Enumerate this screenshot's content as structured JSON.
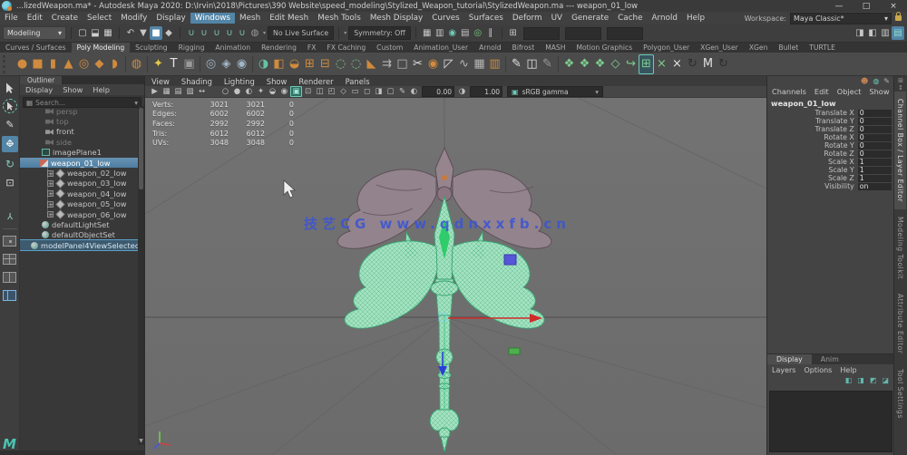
{
  "window": {
    "title": "...lizedWeapon.ma* - Autodesk Maya 2020: D:\\Irvin\\2018\\Pictures\\390 Website\\speed_modeling\\Stylized_Weapon_tutorial\\StylizedWeapon.ma  ---  weapon_01_low",
    "minimize": "—",
    "maximize": "□",
    "close": "×"
  },
  "branding": {
    "logo": "M"
  },
  "menubar": {
    "items": [
      {
        "t": "File"
      },
      {
        "t": "Edit"
      },
      {
        "t": "Create"
      },
      {
        "t": "Select"
      },
      {
        "t": "Modify"
      },
      {
        "t": "Display"
      },
      {
        "t": "Windows",
        "s": "active"
      },
      {
        "t": "Mesh"
      },
      {
        "t": "Edit Mesh"
      },
      {
        "t": "Mesh Tools"
      },
      {
        "t": "Mesh Display"
      },
      {
        "t": "Curves"
      },
      {
        "t": "Surfaces"
      },
      {
        "t": "Deform"
      },
      {
        "t": "UV"
      },
      {
        "t": "Generate"
      },
      {
        "t": "Cache"
      },
      {
        "t": "Arnold"
      },
      {
        "t": "Help"
      }
    ],
    "workspace_label": "Workspace:",
    "workspace_value": "Maya Classic*",
    "workspace_dd": "▾"
  },
  "statusline": {
    "mode": "Modeling",
    "mode_dd": "▾",
    "file_icons": [
      {
        "n": "new-scene-icon",
        "g": "▢",
        "c": "#cfcfcf"
      },
      {
        "n": "open-scene-icon",
        "g": "⬓",
        "c": "#cfcfcf"
      },
      {
        "n": "save-scene-icon",
        "g": "▦",
        "c": "#cfcfcf"
      }
    ],
    "edit_icons": [
      {
        "n": "undo-icon",
        "g": "↶",
        "c": "#c6c6c6"
      },
      {
        "n": "select-hierarchy-icon",
        "g": "▼",
        "c": "#c6c6c6"
      },
      {
        "n": "select-object-icon",
        "g": "■",
        "c": "#fff",
        "s": "active"
      },
      {
        "n": "select-component-icon",
        "g": "◆",
        "c": "#c6c6c6"
      }
    ],
    "snap_icons": [
      {
        "n": "snap-grid-icon",
        "g": "∪",
        "c": "#7ec8b8"
      },
      {
        "n": "snap-curve-icon",
        "g": "∪",
        "c": "#7ec8b8"
      },
      {
        "n": "snap-point-icon",
        "g": "∪",
        "c": "#7ec8b8"
      },
      {
        "n": "snap-projected-center-icon",
        "g": "∪",
        "c": "#7ec8b8"
      },
      {
        "n": "snap-view-plane-icon",
        "g": "∪",
        "c": "#7ec8b8"
      },
      {
        "n": "make-live-icon",
        "g": "◍",
        "c": "#9a9a9a"
      }
    ],
    "no_live_surface": "No Live Surface",
    "symmetry": "Symmetry: Off",
    "render_icons": [
      {
        "n": "render-icon",
        "g": "▦",
        "c": "#c6c6c6"
      },
      {
        "n": "ipr-render-icon",
        "g": "▥",
        "c": "#c6c6c6"
      },
      {
        "n": "render-settings-icon",
        "g": "◉",
        "c": "#6ec9b8"
      },
      {
        "n": "display-layers-icon",
        "g": "▤",
        "c": "#c6c6c6"
      },
      {
        "n": "launch-render-view-icon",
        "g": "◎",
        "c": "#7ec87e"
      },
      {
        "n": "pause-icon",
        "g": "∥",
        "c": "#c6c6c6"
      }
    ],
    "input_icon": {
      "n": "quick-input-icon",
      "g": "⊞",
      "c": "#c6c6c6"
    },
    "right_icons": [
      {
        "n": "sidebar-attribute-editor-icon",
        "g": "◨",
        "c": "#c6c6c6"
      },
      {
        "n": "sidebar-tool-settings-icon",
        "g": "◧",
        "c": "#c6c6c6"
      },
      {
        "n": "sidebar-channel-box-icon",
        "g": "▥",
        "c": "#c6c6c6"
      },
      {
        "n": "sidebar-modeling-toolkit-icon",
        "g": "▤",
        "c": "#8fe0d0",
        "s": "active"
      }
    ]
  },
  "shelf": {
    "tabs": [
      {
        "t": "Curves / Surfaces"
      },
      {
        "t": "Poly Modeling",
        "s": "active"
      },
      {
        "t": "Sculpting"
      },
      {
        "t": "Rigging"
      },
      {
        "t": "Animation"
      },
      {
        "t": "Rendering"
      },
      {
        "t": "FX"
      },
      {
        "t": "FX Caching"
      },
      {
        "t": "Custom"
      },
      {
        "t": "Animation_User"
      },
      {
        "t": "Arnold"
      },
      {
        "t": "Bifrost"
      },
      {
        "t": "MASH"
      },
      {
        "t": "Motion Graphics"
      },
      {
        "t": "Polygon_User"
      },
      {
        "t": "XGen_User"
      },
      {
        "t": "XGen"
      },
      {
        "t": "Bullet"
      },
      {
        "t": "TURTLE"
      }
    ],
    "icons": [
      {
        "n": "poly-sphere-icon",
        "g": "●",
        "c": "#d08b3e"
      },
      {
        "n": "poly-cube-icon",
        "g": "■",
        "c": "#d08b3e"
      },
      {
        "n": "poly-cylinder-icon",
        "g": "▮",
        "c": "#d08b3e"
      },
      {
        "n": "poly-cone-icon",
        "g": "▲",
        "c": "#d08b3e"
      },
      {
        "n": "poly-torus-icon",
        "g": "◎",
        "c": "#d08b3e"
      },
      {
        "n": "poly-plane-icon",
        "g": "◆",
        "c": "#d08b3e"
      },
      {
        "n": "poly-disc-icon",
        "g": "◗",
        "c": "#d08b3e"
      },
      {
        "s": "sep"
      },
      {
        "n": "platonic-solid-icon",
        "g": "◍",
        "c": "#d08b3e"
      },
      {
        "s": "sep"
      },
      {
        "n": "super-shape-icon",
        "g": "✦",
        "c": "#e6c84a"
      },
      {
        "n": "poly-type-icon",
        "g": "T",
        "c": "#e4e4e4"
      },
      {
        "n": "type-editor-icon",
        "g": "▣",
        "c": "#9a9a9a"
      },
      {
        "s": "sep"
      },
      {
        "n": "camera-aim-icon",
        "g": "◎",
        "c": "#9fb6c6"
      },
      {
        "n": "camera-key-icon",
        "g": "◈",
        "c": "#9fb6c6"
      },
      {
        "n": "motion-trail-icon",
        "g": "◉",
        "c": "#9fb6c6"
      },
      {
        "s": "sep"
      },
      {
        "n": "combine-icon",
        "g": "◑",
        "c": "#66c2a4"
      },
      {
        "n": "separate-icon",
        "g": "◧",
        "c": "#d08b3e"
      },
      {
        "n": "extract-icon",
        "g": "◒",
        "c": "#d08b3e"
      },
      {
        "n": "boolean-union-icon",
        "g": "⊞",
        "c": "#d08b3e"
      },
      {
        "n": "boolean-difference-icon",
        "g": "⊟",
        "c": "#d08b3e"
      },
      {
        "n": "bridge-icon",
        "g": "◌",
        "c": "#7ccc8e"
      },
      {
        "n": "append-polygon-icon",
        "g": "◌",
        "c": "#7ccc8e"
      },
      {
        "n": "bevel-icon",
        "g": "◣",
        "c": "#d08b3e"
      },
      {
        "n": "smooth-icon",
        "g": "⇉",
        "c": "#b5b5b5"
      },
      {
        "n": "cube-wire-icon",
        "g": "□",
        "c": "#b5b5b5"
      },
      {
        "n": "multi-cut-icon",
        "g": "✂",
        "c": "#e0e0e0"
      },
      {
        "n": "circularize-icon",
        "g": "◉",
        "c": "#d08b3e"
      },
      {
        "n": "fold-icon",
        "g": "◸",
        "c": "#e0e0e0"
      },
      {
        "n": "edge-flow-icon",
        "g": "∿",
        "c": "#b5b5b5"
      },
      {
        "n": "uv-snapshot-icon",
        "g": "▦",
        "c": "#b5b5b5"
      },
      {
        "n": "poly-count-icon",
        "g": "▥",
        "c": "#d08b3e"
      },
      {
        "s": "sep"
      },
      {
        "n": "create-curve-icon",
        "g": "✎",
        "c": "#e0e0e0"
      },
      {
        "n": "edit-curve-icon",
        "g": "◫",
        "c": "#e0e0e0"
      },
      {
        "n": "pencil-curve-icon",
        "g": "✎",
        "c": "#9a9a9a"
      },
      {
        "s": "sep"
      },
      {
        "n": "quad-draw-icon",
        "g": "❖",
        "c": "#7ccc8e"
      },
      {
        "n": "quad-relax-icon",
        "g": "❖",
        "c": "#7ccc8e"
      },
      {
        "n": "quad-tweak-icon",
        "g": "❖",
        "c": "#7ccc8e"
      },
      {
        "n": "green-cube-icon",
        "g": "◇",
        "c": "#7ccc8e"
      },
      {
        "n": "edge-loop-icon",
        "g": "↪",
        "c": "#7ccc8e"
      },
      {
        "n": "grid-fill-icon",
        "g": "⊞",
        "c": "#7ccc8e",
        "s": "active"
      },
      {
        "n": "cut-green-icon",
        "g": "×",
        "c": "#7ccc8e"
      },
      {
        "n": "delete-edge-icon",
        "g": "×",
        "c": "#e0e0e0"
      },
      {
        "n": "target-weld-icon",
        "g": "↻",
        "c": "#2e2e2e"
      },
      {
        "n": "mirror-icon",
        "g": "M",
        "c": "#e0e0e0"
      },
      {
        "n": "symmetrize-icon",
        "g": "↻",
        "c": "#2e2e2e"
      }
    ]
  },
  "toolbox": {
    "tools": [
      "select-tool",
      "lasso-tool",
      "paint-select-tool",
      "move-tool",
      "rotate-tool",
      "scale-tool",
      "ik-handle-tool",
      "layout-single-pane",
      "layout-four-pane",
      "layout-two-pane",
      "layout-outliner-persp"
    ]
  },
  "outliner": {
    "tab": "Outliner",
    "menus": [
      {
        "t": "Display"
      },
      {
        "t": "Show"
      },
      {
        "t": "Help"
      }
    ],
    "search": "Search...",
    "items": [
      {
        "t": "persp",
        "i": "camera",
        "s": "dim",
        "ind": 28
      },
      {
        "t": "top",
        "i": "camera",
        "s": "dim",
        "ind": 28
      },
      {
        "t": "front",
        "i": "camera",
        "ind": 28
      },
      {
        "t": "side",
        "i": "camera",
        "s": "dim",
        "ind": 28
      },
      {
        "t": "imagePlane1",
        "i": "imageplane",
        "ind": 24
      },
      {
        "t": "weapon_01_low",
        "i": "mesh-main",
        "s": "selected",
        "ind": 22
      },
      {
        "t": "weapon_02_low",
        "i": "mesh",
        "x": "+",
        "ind": 30
      },
      {
        "t": "weapon_03_low",
        "i": "mesh",
        "x": "+",
        "ind": 30
      },
      {
        "t": "weapon_04_low",
        "i": "mesh",
        "x": "+",
        "ind": 30
      },
      {
        "t": "weapon_05_low",
        "i": "mesh",
        "x": "+",
        "ind": 30
      },
      {
        "t": "weapon_06_low",
        "i": "mesh",
        "x": "+",
        "ind": 30
      },
      {
        "t": "defaultLightSet",
        "i": "set",
        "ind": 24
      },
      {
        "t": "defaultObjectSet",
        "i": "set",
        "ind": 24
      },
      {
        "t": "modelPanel4ViewSelectedSet",
        "i": "panelset",
        "s": "hl",
        "ind": 12
      }
    ]
  },
  "viewport": {
    "menus": [
      {
        "t": "View"
      },
      {
        "t": "Shading"
      },
      {
        "t": "Lighting"
      },
      {
        "t": "Show"
      },
      {
        "t": "Renderer"
      },
      {
        "t": "Panels"
      }
    ],
    "toolbar": {
      "icons": [
        {
          "n": "select-camera-icon",
          "g": "▶"
        },
        {
          "n": "camera-attributes-icon",
          "g": "▦"
        },
        {
          "n": "bookmarks-icon",
          "g": "▤"
        },
        {
          "n": "image-plane-icon",
          "g": "▧"
        },
        {
          "n": "pan-zoom-icon",
          "g": "↔"
        },
        {
          "s": "sep",
          "g": ""
        },
        {
          "n": "wireframe-icon",
          "g": "○"
        },
        {
          "n": "shaded-icon",
          "g": "●"
        },
        {
          "n": "textured-icon",
          "g": "◐"
        },
        {
          "n": "lights-icon",
          "g": "✦"
        },
        {
          "n": "shadows-icon",
          "g": "◒"
        },
        {
          "n": "screen-ao-icon",
          "g": "◉"
        },
        {
          "n": "textured-mode-icon",
          "g": "▣",
          "s": "active"
        },
        {
          "n": "isolate-select-icon",
          "g": "⊡"
        },
        {
          "n": "xray-icon",
          "g": "◫"
        },
        {
          "n": "wireframe-on-shaded-icon",
          "g": "◰"
        },
        {
          "n": "default-material-icon",
          "g": "◇"
        },
        {
          "n": "field-chart-icon",
          "g": "▭"
        },
        {
          "n": "resolution-gate-icon",
          "g": "◻"
        },
        {
          "n": "gate-mask-icon",
          "g": "◨"
        },
        {
          "n": "safe-action-icon",
          "g": "▢"
        },
        {
          "n": "grease-pencil-icon",
          "g": "✎"
        }
      ],
      "exposure_icon": "◐",
      "exposure": "0.00",
      "gamma_icon": "◑",
      "gamma": "1.00",
      "view_transform_label": "sRGB gamma",
      "dd": "▾"
    },
    "hud": {
      "rows": [
        {
          "t": "Verts:",
          "a": "3021",
          "b": "3021",
          "c": "0"
        },
        {
          "t": "Edges:",
          "a": "6002",
          "b": "6002",
          "c": "0"
        },
        {
          "t": "Faces:",
          "a": "2992",
          "b": "2992",
          "c": "0"
        },
        {
          "t": "Tris:",
          "a": "6012",
          "b": "6012",
          "c": "0"
        },
        {
          "t": "UVs:",
          "a": "3048",
          "b": "3048",
          "c": "0"
        }
      ]
    },
    "watermark": "技艺CG www.qdnxxfb.cn"
  },
  "channel_box": {
    "icons": [
      {
        "n": "character-set-icon",
        "g": "☻",
        "c": "#cc8855"
      },
      {
        "n": "world-space-icon",
        "g": "◍",
        "c": "#6ec9b8"
      },
      {
        "n": "edit-channels-icon",
        "g": "✎",
        "c": "#b5b5b5"
      }
    ],
    "menus": [
      {
        "t": "Channels"
      },
      {
        "t": "Edit"
      },
      {
        "t": "Object"
      },
      {
        "t": "Show"
      }
    ],
    "object": "weapon_01_low",
    "rows": [
      {
        "t": "Translate X",
        "v": "0"
      },
      {
        "t": "Translate Y",
        "v": "0"
      },
      {
        "t": "Translate Z",
        "v": "0"
      },
      {
        "t": "Rotate X",
        "v": "0"
      },
      {
        "t": "Rotate Y",
        "v": "0"
      },
      {
        "t": "Rotate Z",
        "v": "0"
      },
      {
        "t": "Scale X",
        "v": "1"
      },
      {
        "t": "Scale Y",
        "v": "1"
      },
      {
        "t": "Scale Z",
        "v": "1"
      },
      {
        "t": "Visibility",
        "v": "on"
      }
    ]
  },
  "layer_editor": {
    "tabs": [
      {
        "t": "Display",
        "s": "active"
      },
      {
        "t": "Anim"
      }
    ],
    "menus": [
      {
        "t": "Layers"
      },
      {
        "t": "Options"
      },
      {
        "t": "Help"
      }
    ],
    "icons": [
      {
        "n": "layer-empty-icon",
        "g": "◧",
        "c": "#62b8ac"
      },
      {
        "n": "layer-selected-icon",
        "g": "◨",
        "c": "#62b8ac"
      },
      {
        "n": "layer-new-icon",
        "g": "◩",
        "c": "#62b8ac"
      },
      {
        "n": "layer-new-selected-icon",
        "g": "◪",
        "c": "#62b8ac"
      }
    ]
  },
  "right_tabs": [
    {
      "t": "Channel Box / Layer Editor",
      "s": "active"
    },
    {
      "t": "Modeling Toolkit"
    },
    {
      "t": "Attribute Editor"
    },
    {
      "t": "Tool Settings"
    }
  ],
  "colors": {
    "accent_blue": "#5285a6",
    "wireframe_green": "#2ecc6a",
    "model_teal": "#a8ecc8",
    "axis_red": "#d02b2b",
    "axis_blue": "#2b3fd6",
    "watermark_blue": "#3c55d4"
  }
}
